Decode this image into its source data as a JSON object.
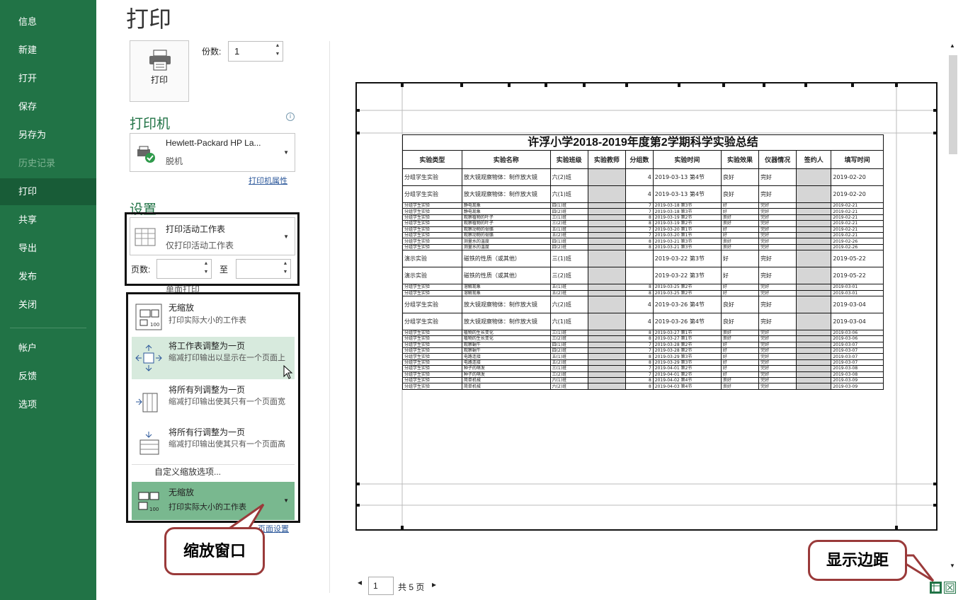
{
  "page_title": "打印",
  "sidebar": {
    "items": [
      {
        "label": "信息",
        "state": "normal"
      },
      {
        "label": "新建",
        "state": "normal"
      },
      {
        "label": "打开",
        "state": "normal"
      },
      {
        "label": "保存",
        "state": "normal"
      },
      {
        "label": "另存为",
        "state": "normal"
      },
      {
        "label": "历史记录",
        "state": "disabled"
      },
      {
        "label": "打印",
        "state": "active"
      },
      {
        "label": "共享",
        "state": "normal"
      },
      {
        "label": "导出",
        "state": "normal"
      },
      {
        "label": "发布",
        "state": "normal"
      },
      {
        "label": "关闭",
        "state": "normal"
      },
      {
        "label": "帐户",
        "state": "normal"
      },
      {
        "label": "反馈",
        "state": "normal"
      },
      {
        "label": "选项",
        "state": "normal"
      }
    ]
  },
  "print_button": {
    "label": "打印",
    "icon": "printer-icon"
  },
  "copies": {
    "label": "份数:",
    "value": "1"
  },
  "printer": {
    "heading": "打印机",
    "name": "Hewlett-Packard HP La...",
    "status": "脱机",
    "properties_link": "打印机属性"
  },
  "settings": {
    "heading": "设置",
    "scope": {
      "title": "打印活动工作表",
      "subtitle": "仅打印活动工作表"
    },
    "pages_label": "页数:",
    "to_label": "至",
    "partial_hidden_text": "单面打印"
  },
  "scaling_menu": {
    "items": [
      {
        "title": "无缩放",
        "subtitle": "打印实际大小的工作表",
        "icon": "no-scaling-icon"
      },
      {
        "title": "将工作表调整为一页",
        "subtitle": "缩减打印输出以显示在一个页面上",
        "icon": "fit-sheet-icon"
      },
      {
        "title": "将所有列调整为一页",
        "subtitle": "缩减打印输出使其只有一个页面宽",
        "icon": "fit-columns-icon"
      },
      {
        "title": "将所有行调整为一页",
        "subtitle": "缩减打印输出使其只有一个页面高",
        "icon": "fit-rows-icon"
      }
    ],
    "custom_option": "自定义缩放选项..."
  },
  "scaling_current": {
    "title": "无缩放",
    "subtitle": "打印实际大小的工作表"
  },
  "page_setup_link": "页面设置",
  "annotations": {
    "zoom_window": "缩放窗口",
    "show_margins": "显示边距"
  },
  "pager": {
    "current": "1",
    "total_label": "共 5 页"
  },
  "preview": {
    "sheet_title": "许浮小学2018-2019年度第2学期科学实验总结",
    "columns": [
      "实验类型",
      "实验名称",
      "实验班级",
      "实验教师",
      "分组数",
      "实验时间",
      "实验效果",
      "仪器情况",
      "签约人",
      "填写时间"
    ],
    "rows": [
      [
        "分组学生实验",
        "放大镜观察物体：制作放大镜",
        "六(2)班",
        "",
        "4",
        "2019-03-13 第4节",
        "良好",
        "完好",
        "",
        "2019-02-20"
      ],
      [
        "分组学生实验",
        "放大镜观察物体：制作放大镜",
        "六(1)班",
        "",
        "4",
        "2019-03-13 第4节",
        "良好",
        "完好",
        "",
        "2019-02-20"
      ],
      [
        "分组学生实验",
        "静电现象",
        "四(1)班",
        "",
        "7",
        "2019-03-18 第3节",
        "好",
        "完好",
        "",
        "2019-02-21"
      ],
      [
        "分组学生实验",
        "静电现象",
        "四(2)班",
        "",
        "7",
        "2019-03-18 第3节",
        "好",
        "完好",
        "",
        "2019-02-21"
      ],
      [
        "分组学生实验",
        "观察植物的叶子",
        "三(1)班",
        "",
        "8",
        "2019-03-19 第2节",
        "良好",
        "完好",
        "",
        "2019-02-21"
      ],
      [
        "分组学生实验",
        "观察植物的叶子",
        "三(2)班",
        "",
        "8",
        "2019-03-19 第2节",
        "良好",
        "完好",
        "",
        "2019-02-21"
      ],
      [
        "分组学生实验",
        "观察动物的骨骼",
        "五(1)班",
        "",
        "7",
        "2019-03-20 第1节",
        "好",
        "完好",
        "",
        "2019-02-21"
      ],
      [
        "分组学生实验",
        "观察动物的骨骼",
        "五(2)班",
        "",
        "7",
        "2019-03-20 第1节",
        "好",
        "完好",
        "",
        "2019-02-21"
      ],
      [
        "分组学生实验",
        "测量水的温度",
        "四(1)班",
        "",
        "8",
        "2019-03-21 第3节",
        "良好",
        "完好",
        "",
        "2019-02-26"
      ],
      [
        "分组学生实验",
        "测量水的温度",
        "四(2)班",
        "",
        "8",
        "2019-03-21 第3节",
        "良好",
        "完好",
        "",
        "2019-02-26"
      ],
      [
        "演示实验",
        "磁铁的性质（或其他）",
        "三(1)班",
        "",
        "",
        "2019-03-22 第3节",
        "好",
        "完好",
        "",
        "2019-05-22"
      ],
      [
        "演示实验",
        "磁铁的性质（或其他）",
        "三(2)班",
        "",
        "",
        "2019-03-22 第3节",
        "好",
        "完好",
        "",
        "2019-05-22"
      ],
      [
        "分组学生实验",
        "溶解现象",
        "五(1)班",
        "",
        "8",
        "2019-03-25 第2节",
        "好",
        "完好",
        "",
        "2019-03-01"
      ],
      [
        "分组学生实验",
        "溶解现象",
        "五(2)班",
        "",
        "8",
        "2019-03-25 第2节",
        "好",
        "完好",
        "",
        "2019-03-01"
      ],
      [
        "分组学生实验",
        "放大镜观察物体：制作放大镜",
        "六(2)班",
        "",
        "4",
        "2019-03-26 第4节",
        "良好",
        "完好",
        "",
        "2019-03-04"
      ],
      [
        "分组学生实验",
        "放大镜观察物体：制作放大镜",
        "六(1)班",
        "",
        "4",
        "2019-03-26 第4节",
        "良好",
        "完好",
        "",
        "2019-03-04"
      ],
      [
        "分组学生实验",
        "植物的生长变化",
        "三(1)班",
        "",
        "8",
        "2019-03-27 第1节",
        "良好",
        "完好",
        "",
        "2019-03-06"
      ],
      [
        "分组学生实验",
        "植物的生长变化",
        "三(2)班",
        "",
        "8",
        "2019-03-27 第1节",
        "良好",
        "完好",
        "",
        "2019-03-06"
      ],
      [
        "分组学生实验",
        "观察蜗牛",
        "四(1)班",
        "",
        "7",
        "2019-03-28 第2节",
        "好",
        "完好",
        "",
        "2019-03-07"
      ],
      [
        "分组学生实验",
        "观察蜗牛",
        "四(2)班",
        "",
        "7",
        "2019-03-28 第2节",
        "好",
        "完好",
        "",
        "2019-03-07"
      ],
      [
        "分组学生实验",
        "电路连接",
        "五(1)班",
        "",
        "8",
        "2019-03-29 第3节",
        "好",
        "完好",
        "",
        "2019-03-07"
      ],
      [
        "分组学生实验",
        "电路连接",
        "五(2)班",
        "",
        "8",
        "2019-03-29 第3节",
        "好",
        "完好",
        "",
        "2019-03-07"
      ],
      [
        "分组学生实验",
        "种子的萌发",
        "三(1)班",
        "",
        "7",
        "2019-04-01 第2节",
        "好",
        "完好",
        "",
        "2019-03-08"
      ],
      [
        "分组学生实验",
        "种子的萌发",
        "三(2)班",
        "",
        "7",
        "2019-04-01 第2节",
        "好",
        "完好",
        "",
        "2019-03-08"
      ],
      [
        "分组学生实验",
        "简单机械",
        "六(1)班",
        "",
        "8",
        "2019-04-02 第4节",
        "良好",
        "完好",
        "",
        "2019-03-09"
      ],
      [
        "分组学生实验",
        "简单机械",
        "六(2)班",
        "",
        "8",
        "2019-04-03 第4节",
        "良好",
        "完好",
        "",
        "2019-03-09"
      ]
    ]
  }
}
